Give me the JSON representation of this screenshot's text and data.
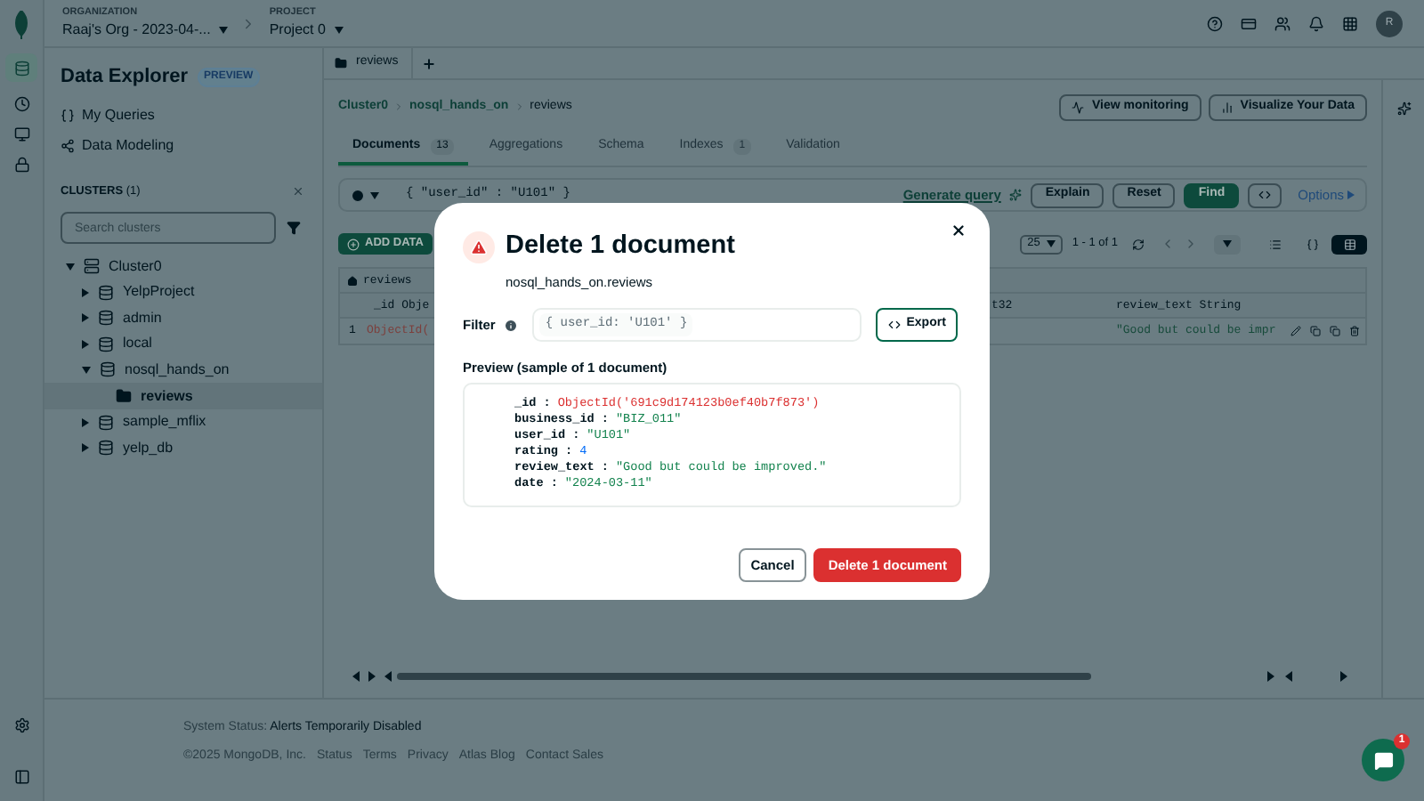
{
  "topbar": {
    "org_label": "ORGANIZATION",
    "org_value": "Raaj's Org - 2023-04-...",
    "project_label": "PROJECT",
    "project_value": "Project 0",
    "avatar": "R"
  },
  "sidebar": {
    "title": "Data Explorer",
    "badge": "PREVIEW",
    "links": [
      "My Queries",
      "Data Modeling"
    ],
    "clusters_label": "CLUSTERS",
    "clusters_count": "(1)",
    "search_placeholder": "Search clusters",
    "tree": [
      {
        "label": "Cluster0",
        "kind": "cluster",
        "expanded": true,
        "selected": false,
        "children": [
          {
            "label": "YelpProject",
            "kind": "database",
            "expanded": false,
            "selected": false
          },
          {
            "label": "admin",
            "kind": "database",
            "expanded": false,
            "selected": false
          },
          {
            "label": "local",
            "kind": "database",
            "expanded": false,
            "selected": false
          },
          {
            "label": "nosql_hands_on",
            "kind": "database",
            "expanded": true,
            "selected": false,
            "children": [
              {
                "label": "reviews",
                "kind": "collection",
                "selected": true
              }
            ]
          },
          {
            "label": "sample_mflix",
            "kind": "database",
            "expanded": false,
            "selected": false
          },
          {
            "label": "yelp_db",
            "kind": "database",
            "expanded": false,
            "selected": false
          }
        ]
      }
    ]
  },
  "workspace_tabs": [
    {
      "label": "reviews",
      "selected": true
    }
  ],
  "breadcrumb": [
    "Cluster0",
    "nosql_hands_on",
    "reviews"
  ],
  "header_buttons": [
    "View monitoring",
    "Visualize Your Data"
  ],
  "collection_tabs": [
    {
      "label": "Documents",
      "count": "13",
      "selected": true
    },
    {
      "label": "Aggregations",
      "selected": false
    },
    {
      "label": "Schema",
      "selected": false
    },
    {
      "label": "Indexes",
      "count": "1",
      "selected": false
    },
    {
      "label": "Validation",
      "selected": false
    }
  ],
  "query_bar": {
    "filter": "{ \"user_id\" : \"U101\" }",
    "generate": "Generate query",
    "buttons": [
      "Explain",
      "Reset",
      "Find"
    ],
    "options": "Options"
  },
  "toolbar": {
    "add_data": "ADD DATA",
    "page_size": "25",
    "range": "1 - 1 of 1",
    "views": [
      {
        "kind": "list",
        "selected": false
      },
      {
        "kind": "json",
        "selected": false
      },
      {
        "kind": "table",
        "selected": true
      }
    ]
  },
  "table": {
    "collection": "reviews",
    "columns": [
      "_id Obje",
      "t32",
      "review_text String"
    ],
    "rows": [
      {
        "index": "1",
        "cells": [
          "ObjectId(",
          "",
          "\"Good but could be impr"
        ]
      }
    ]
  },
  "modal": {
    "title": "Delete 1 document",
    "namespace": "nosql_hands_on.reviews",
    "filter_label": "Filter",
    "filter_value": "{ user_id: 'U101' }",
    "export": "Export",
    "preview_label": "Preview (sample of 1 document)",
    "fields": [
      {
        "key": "_id",
        "sep": ":",
        "value": "ObjectId('691c9d174123b0ef40b7f873')",
        "kind": "objectid"
      },
      {
        "key": "business_id",
        "sep": ":",
        "value": "\"BIZ_011\"",
        "kind": "string"
      },
      {
        "key": "user_id",
        "sep": ":",
        "value": "\"U101\"",
        "kind": "string"
      },
      {
        "key": "rating",
        "sep": ":",
        "value": "4",
        "kind": "number"
      },
      {
        "key": "review_text",
        "sep": ":",
        "value": "\"Good but could be improved.\"",
        "kind": "string"
      },
      {
        "key": "date",
        "sep": ":",
        "value": "\"2024-03-11\"",
        "kind": "string"
      }
    ],
    "cancel": "Cancel",
    "confirm": "Delete 1 document"
  },
  "footer": {
    "status_label": "System Status:",
    "status_value": "Alerts Temporarily Disabled",
    "copyright": "©2025 MongoDB, Inc.",
    "links": [
      "Status",
      "Terms",
      "Privacy",
      "Atlas Blog",
      "Contact Sales"
    ]
  },
  "chat": {
    "badge": "1"
  }
}
